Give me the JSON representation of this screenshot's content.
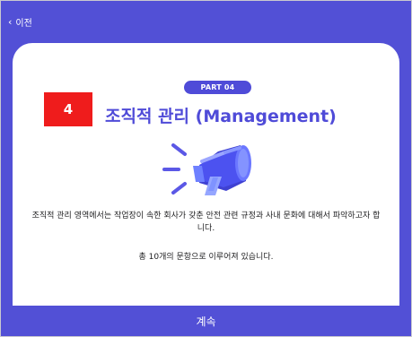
{
  "nav": {
    "back_icon": "chevron-left-icon",
    "back_label": "이전"
  },
  "intro": {
    "part_label": "PART 04",
    "number": "4",
    "title": "조직적 관리 (Management)",
    "illustration": "megaphone-icon",
    "description": "조직적 관리 영역에서는 작업장이 속한 회사가 갖춘 안전 관련 규정과 사내 문화에 대해서 파악하고자 합니다.",
    "question_count": "총 10개의 문항으로 이루어져 있습니다."
  },
  "footer": {
    "continue_label": "계속"
  },
  "colors": {
    "brand": "#5250d6",
    "accent_red": "#ef1c1c",
    "text": "#1d1d1f"
  }
}
